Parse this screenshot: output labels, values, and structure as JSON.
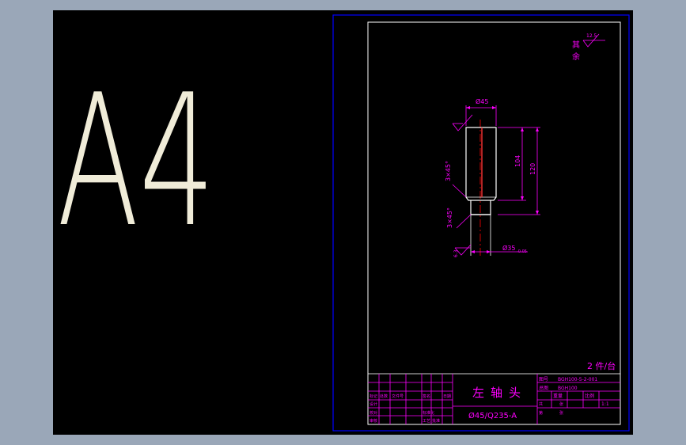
{
  "sheet": {
    "size_label": "A4"
  },
  "drawing": {
    "dims": {
      "top_diameter": "Ø45",
      "bottom_diameter": "Ø35",
      "bottom_tolerance": "-0.05",
      "length_shoulder": "104",
      "length_total": "120",
      "chamfer_top": "3×45°",
      "chamfer_bottom": "3×45°",
      "roughness_left": "6.3"
    },
    "surface_note": {
      "line1": "其",
      "line2": "余",
      "value": "12.5"
    },
    "quantity_note": "2 件/台"
  },
  "title_block": {
    "part_name": "左轴头",
    "material": "Ø45/Q235-A",
    "drawing_no_label": "图号",
    "drawing_no": "BGH100-5-2-001",
    "assembly_label": "总图",
    "assembly_no": "BGH100",
    "scale_value": "1:1",
    "weight_label": "重量",
    "scale_label": "比例",
    "row_labels": [
      "标记",
      "设计",
      "校对",
      "审核"
    ],
    "col_labels": [
      "处数",
      "文件号",
      "签名",
      "日期"
    ],
    "mid_labels": [
      "标准化",
      "工艺",
      "批准"
    ],
    "right_labels": [
      "共",
      "张",
      "第",
      "张"
    ]
  },
  "colors": {
    "background": "#000000",
    "frame": "#0000ff",
    "paper_border": "#ffffff",
    "dimension": "#ff00ff",
    "geometry": "#ffffff",
    "part_edge": "#ff3333",
    "axis": "#ff0000",
    "title_text": "#ff00ff",
    "label_text": "#f0ecd8",
    "canvas_border": "#9aa7b8"
  }
}
